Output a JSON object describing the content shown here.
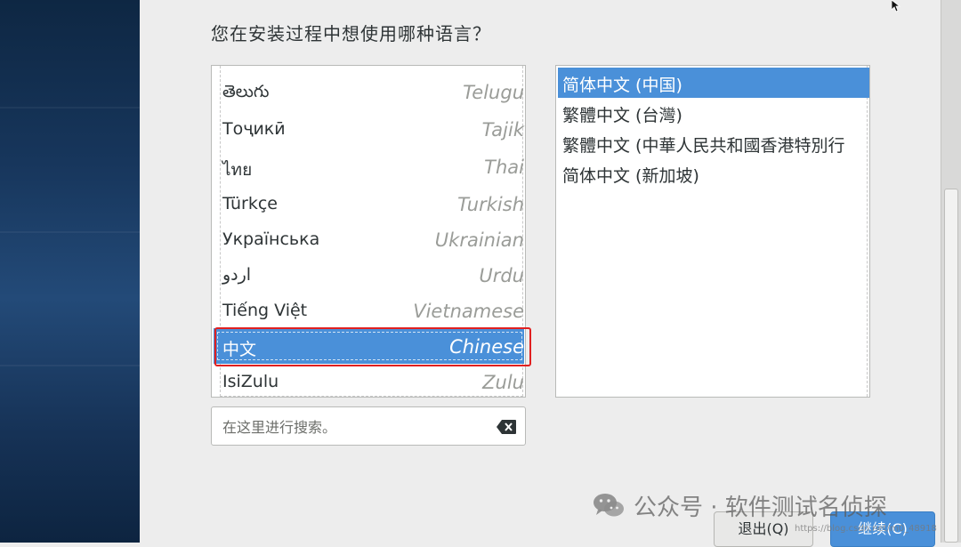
{
  "installer": {
    "question": "您在安装过程中想使用哪种语言？"
  },
  "languages": [
    {
      "native": "తెలుగు",
      "english": "Telugu"
    },
    {
      "native": "Тоҷикӣ",
      "english": "Tajik"
    },
    {
      "native": "ไทย",
      "english": "Thai"
    },
    {
      "native": "Türkçe",
      "english": "Turkish"
    },
    {
      "native": "Українська",
      "english": "Ukrainian"
    },
    {
      "native": "اردو",
      "english": "Urdu"
    },
    {
      "native": "Tiếng Việt",
      "english": "Vietnamese"
    },
    {
      "native": "中文",
      "english": "Chinese"
    },
    {
      "native": "IsiZulu",
      "english": "Zulu"
    }
  ],
  "selected_language": "Chinese",
  "locales": [
    "简体中文 (中国)",
    "繁體中文 (台灣)",
    "繁體中文 (中華人民共和國香港特別行",
    "简体中文 (新加坡)"
  ],
  "selected_locale": "简体中文 (中国)",
  "search": {
    "placeholder": "在这里进行搜索。",
    "value": ""
  },
  "buttons": {
    "quit_label": "退出(Q)",
    "continue_label": "继续(C)"
  },
  "watermark": {
    "text": "公众号 · 软件测试名侦探",
    "url": "https://blog.csdn.net/m0_48918"
  },
  "colors": {
    "selection": "#4a90d9",
    "highlight_box": "#e02020",
    "sidebar": "#17365c"
  }
}
